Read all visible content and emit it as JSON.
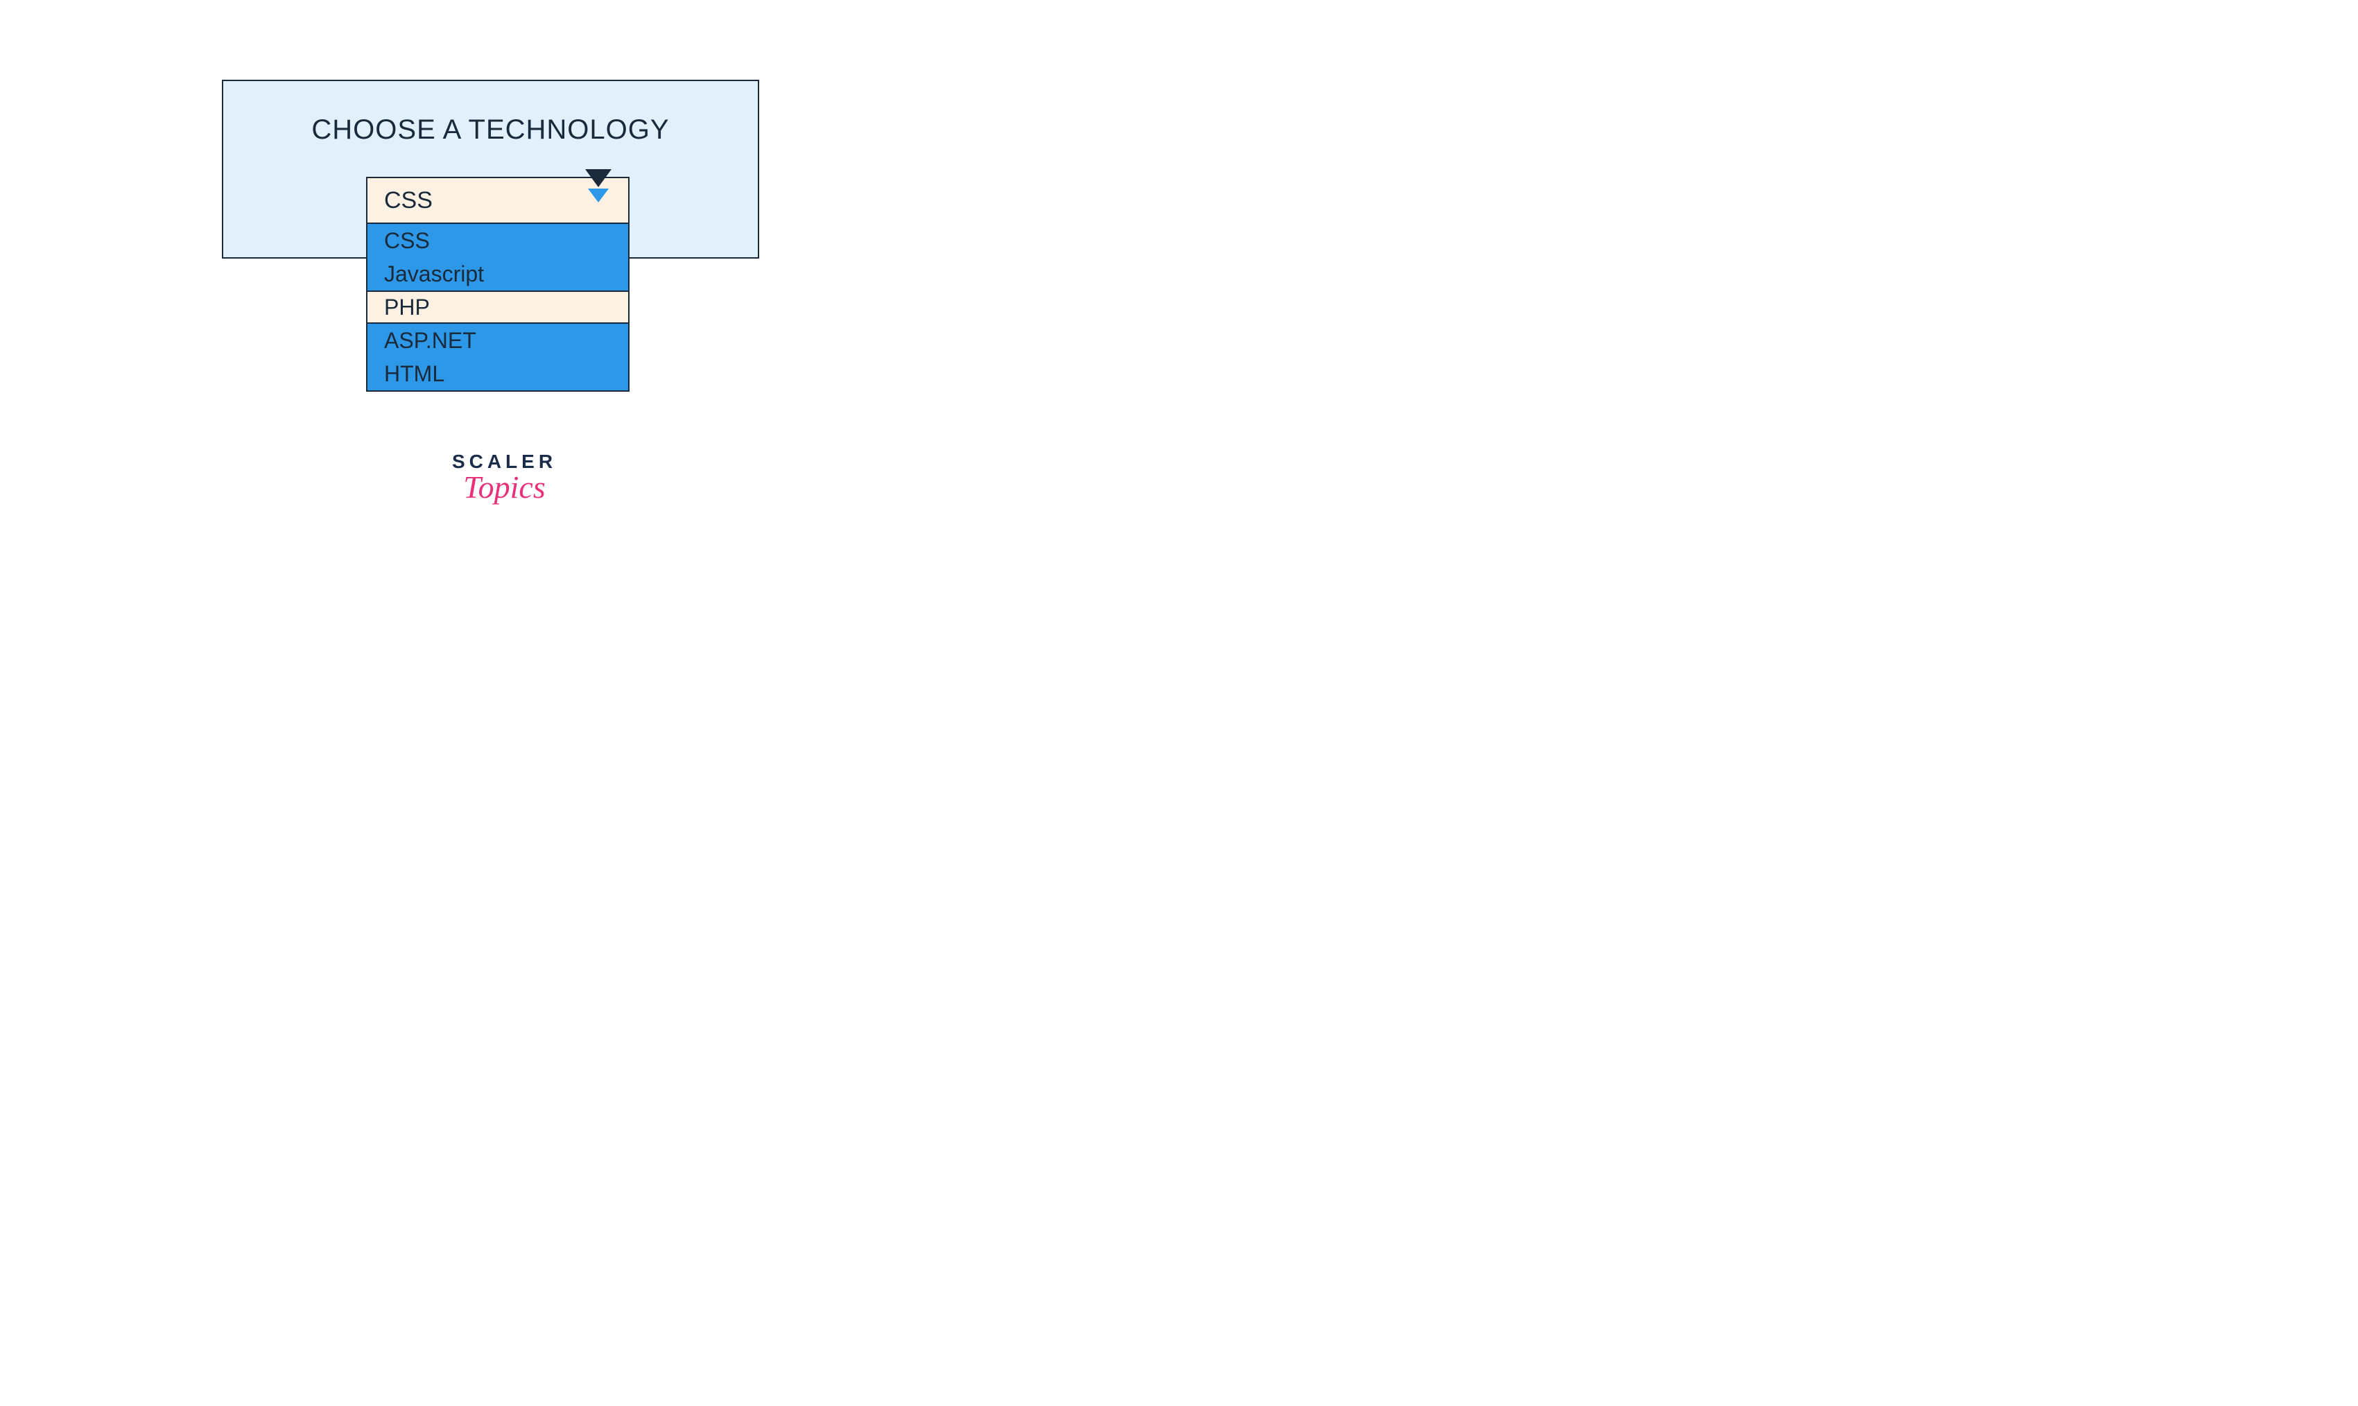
{
  "panel": {
    "title": "CHOOSE A TECHNOLOGY"
  },
  "dropdown": {
    "selected": "CSS",
    "options": [
      "CSS",
      "Javascript",
      "PHP",
      "ASP.NET",
      "HTML"
    ],
    "hovered_index": 2
  },
  "brand": {
    "line1": "SCALER",
    "line2": "Topics"
  },
  "colors": {
    "panel_bg": "#e1f0fb",
    "border": "#1a2a3a",
    "option_bg": "#2e98e8",
    "option_hover_bg": "#fdf1e3",
    "selected_bg": "#fdf1e3",
    "brand_primary": "#1a2c4a",
    "brand_accent": "#e9307b"
  }
}
